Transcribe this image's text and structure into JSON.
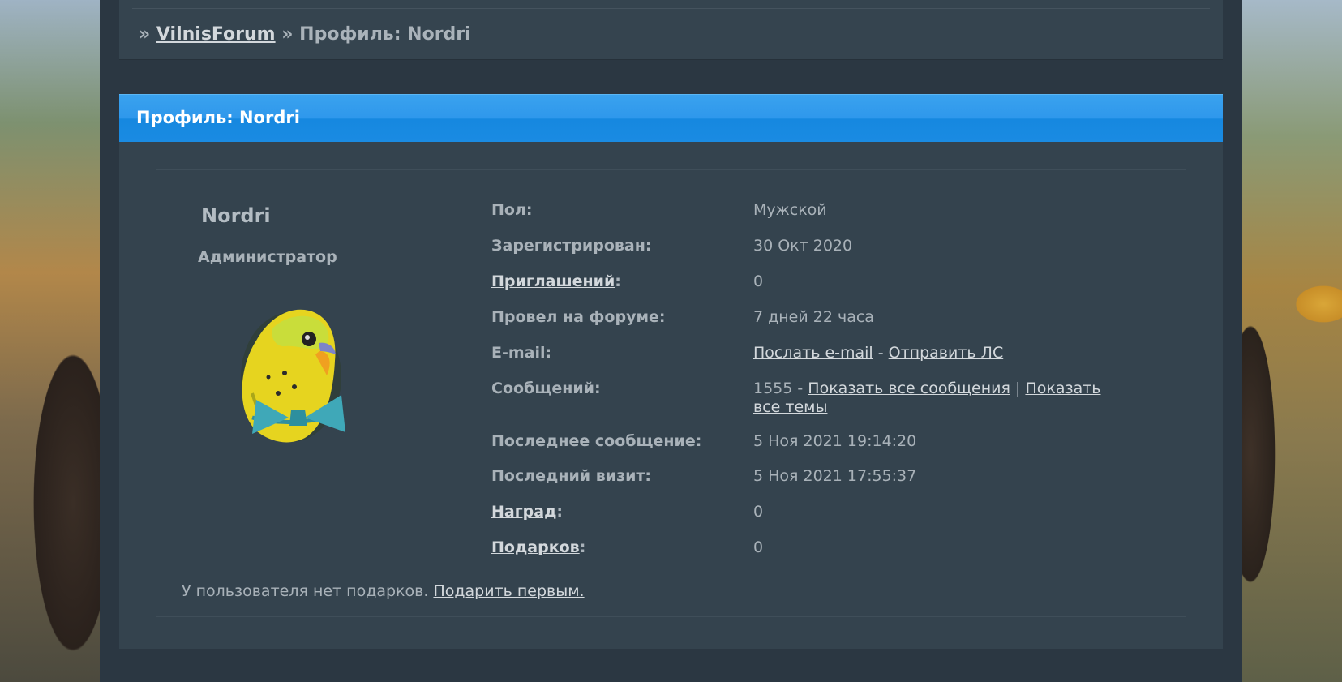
{
  "breadcrumb": {
    "sep1": "»",
    "forum_link": "VilnisForum",
    "sep2": "»",
    "current": "Профиль: Nordri"
  },
  "profile": {
    "title": "Профиль: Nordri",
    "username": "Nordri",
    "role": "Администратор",
    "fields": {
      "gender_label": "Пол:",
      "gender_value": "Мужской",
      "registered_label": "Зарегистрирован:",
      "registered_value": "30 Окт 2020",
      "invites_link": "Приглашений",
      "invites_colon": ":",
      "invites_value": "0",
      "time_label": "Провел на форуме:",
      "time_value": "7 дней 22 часа",
      "email_label": "E-mail:",
      "email_link": "Послать e-mail",
      "email_sep": " - ",
      "pm_link": "Отправить ЛС",
      "posts_label": "Сообщений:",
      "posts_count": "1555",
      "posts_sep": " - ",
      "posts_all_link": "Показать все сообщения",
      "posts_pipe": " | ",
      "topics_all_link": "Показать все темы",
      "last_post_label": "Последнее сообщение:",
      "last_post_value": "5 Ноя 2021 19:14:20",
      "last_visit_label": "Последний визит:",
      "last_visit_value": "5 Ноя 2021 17:55:37",
      "awards_link": "Наград",
      "awards_colon": ":",
      "awards_value": "0",
      "gifts_link": "Подарков",
      "gifts_colon": ":",
      "gifts_value": "0"
    },
    "gifts_note": "У пользователя нет подарков.",
    "gift_first_link": "Подарить первым."
  },
  "colors": {
    "title_bar": "#1a8be2",
    "panel": "#34434e",
    "page": "#2b3742"
  },
  "icons": {
    "avatar": "budgie-avatar"
  }
}
